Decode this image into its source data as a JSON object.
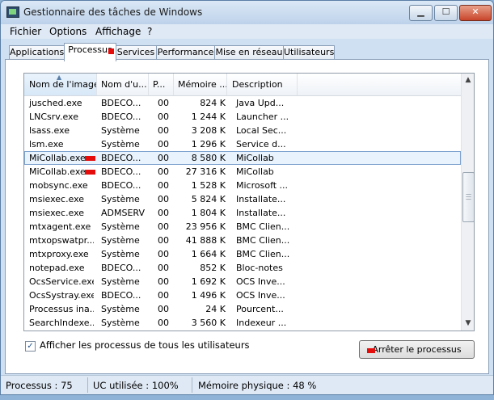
{
  "window": {
    "title": "Gestionnaire des tâches de Windows"
  },
  "menu": [
    "Fichier",
    "Options",
    "Affichage",
    "?"
  ],
  "tabs": [
    "Applications",
    "Processus",
    "Services",
    "Performance",
    "Mise en réseau",
    "Utilisateurs"
  ],
  "active_tab": "Processus",
  "columns": [
    "Nom de l'image",
    "Nom d'u...",
    "P...",
    "Mémoire ...",
    "Description"
  ],
  "rows": [
    [
      "jusched.exe",
      "BDECO...",
      "00",
      "824 K",
      "Java Upd..."
    ],
    [
      "LNCsrv.exe",
      "BDECO...",
      "00",
      "1 244 K",
      "Launcher ..."
    ],
    [
      "lsass.exe",
      "Système",
      "00",
      "3 208 K",
      "Local Sec..."
    ],
    [
      "lsm.exe",
      "Système",
      "00",
      "1 296 K",
      "Service d..."
    ],
    [
      "MiCollab.exe",
      "BDECO...",
      "00",
      "8 580 K",
      "MiCollab"
    ],
    [
      "MiCollab.exe",
      "BDECO...",
      "00",
      "27 316 K",
      "MiCollab"
    ],
    [
      "mobsync.exe",
      "BDECO...",
      "00",
      "1 528 K",
      "Microsoft ..."
    ],
    [
      "msiexec.exe",
      "Système",
      "00",
      "5 824 K",
      "Installate..."
    ],
    [
      "msiexec.exe",
      "ADMSERV",
      "00",
      "1 804 K",
      "Installate..."
    ],
    [
      "mtxagent.exe",
      "Système",
      "00",
      "23 956 K",
      "BMC Clien..."
    ],
    [
      "mtxopswatpr...",
      "Système",
      "00",
      "41 888 K",
      "BMC Clien..."
    ],
    [
      "mtxproxy.exe",
      "Système",
      "00",
      "1 664 K",
      "BMC Clien..."
    ],
    [
      "notepad.exe",
      "BDECO...",
      "00",
      "852 K",
      "Bloc-notes"
    ],
    [
      "OcsService.exe",
      "Système",
      "00",
      "1 692 K",
      "OCS Inve..."
    ],
    [
      "OcsSystray.exe",
      "BDECO...",
      "00",
      "1 496 K",
      "OCS Inve..."
    ],
    [
      "Processus ina...",
      "Système",
      "00",
      "24 K",
      "Pourcent..."
    ],
    [
      "SearchIndexe...",
      "Système",
      "00",
      "3 560 K",
      "Indexeur ..."
    ]
  ],
  "selected_row": 4,
  "show_all_label": "Afficher les processus de tous les utilisateurs",
  "show_all_checked": "✓",
  "end_process_label": "Arrêter le processus",
  "status": {
    "processes": "Processus : 75",
    "cpu": "UC utilisée : 100%",
    "memory": "Mémoire physique : 48 %"
  },
  "colors": {
    "selection": "#e8f3fd",
    "redaction": "#e50c0c"
  }
}
